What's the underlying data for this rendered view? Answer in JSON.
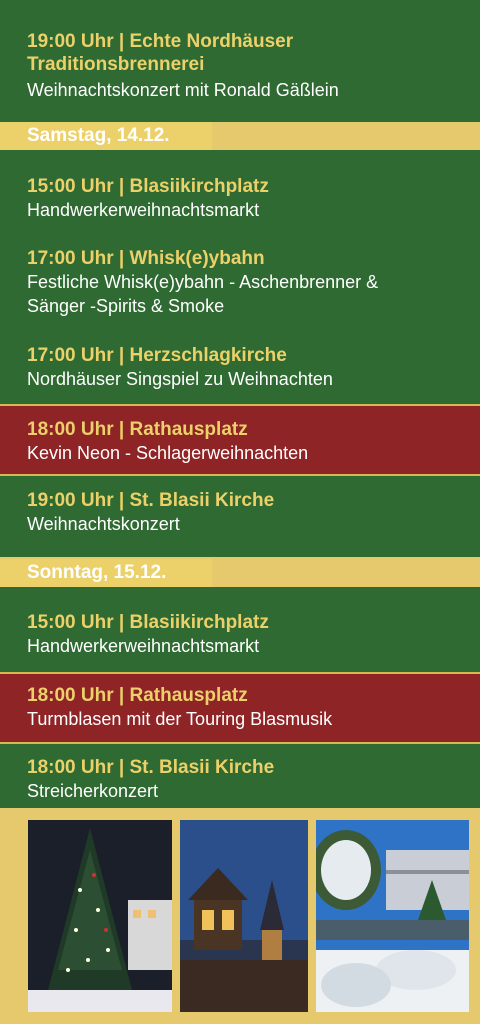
{
  "events_top": [
    {
      "title_line1": "19:00 Uhr | Echte Nordhäuser",
      "title_line2": "Traditionsbrennerei",
      "desc": "Weihnachtskonzert mit Ronald Gäßlein"
    }
  ],
  "saturday": {
    "date": "Samstag, 14.12.",
    "events": [
      {
        "title": "15:00 Uhr | Blasiikirchplatz",
        "desc": "Handwerkerweihnachtsmarkt"
      },
      {
        "title": "17:00 Uhr | Whisk(e)ybahn",
        "desc_line1": "Festliche Whisk(e)ybahn - Aschenbrenner &",
        "desc_line2": "Sänger -Spirits & Smoke"
      },
      {
        "title": "17:00 Uhr | Herzschlagkirche",
        "desc": "Nordhäuser Singspiel zu Weihnachten"
      },
      {
        "title": "18:00 Uhr | Rathausplatz",
        "desc": "Kevin Neon - Schlagerweihnachten"
      },
      {
        "title": "19:00 Uhr | St. Blasii Kirche",
        "desc": "Weihnachtskonzert"
      }
    ]
  },
  "sunday": {
    "date": "Sonntag, 15.12.",
    "events": [
      {
        "title": "15:00 Uhr | Blasiikirchplatz",
        "desc": "Handwerkerweihnachtsmarkt"
      },
      {
        "title": "18:00 Uhr | Rathausplatz",
        "desc": "Turmblasen mit der Touring Blasmusik"
      },
      {
        "title": "18:00 Uhr | St. Blasii Kirche",
        "desc": "Streicherkonzert"
      }
    ]
  },
  "colors": {
    "green": "#2f6a32",
    "red": "#8f2426",
    "gold": "#ecd16a"
  },
  "photos": [
    "christmas-tree-photo",
    "church-tower-photo",
    "snowy-square-photo"
  ]
}
